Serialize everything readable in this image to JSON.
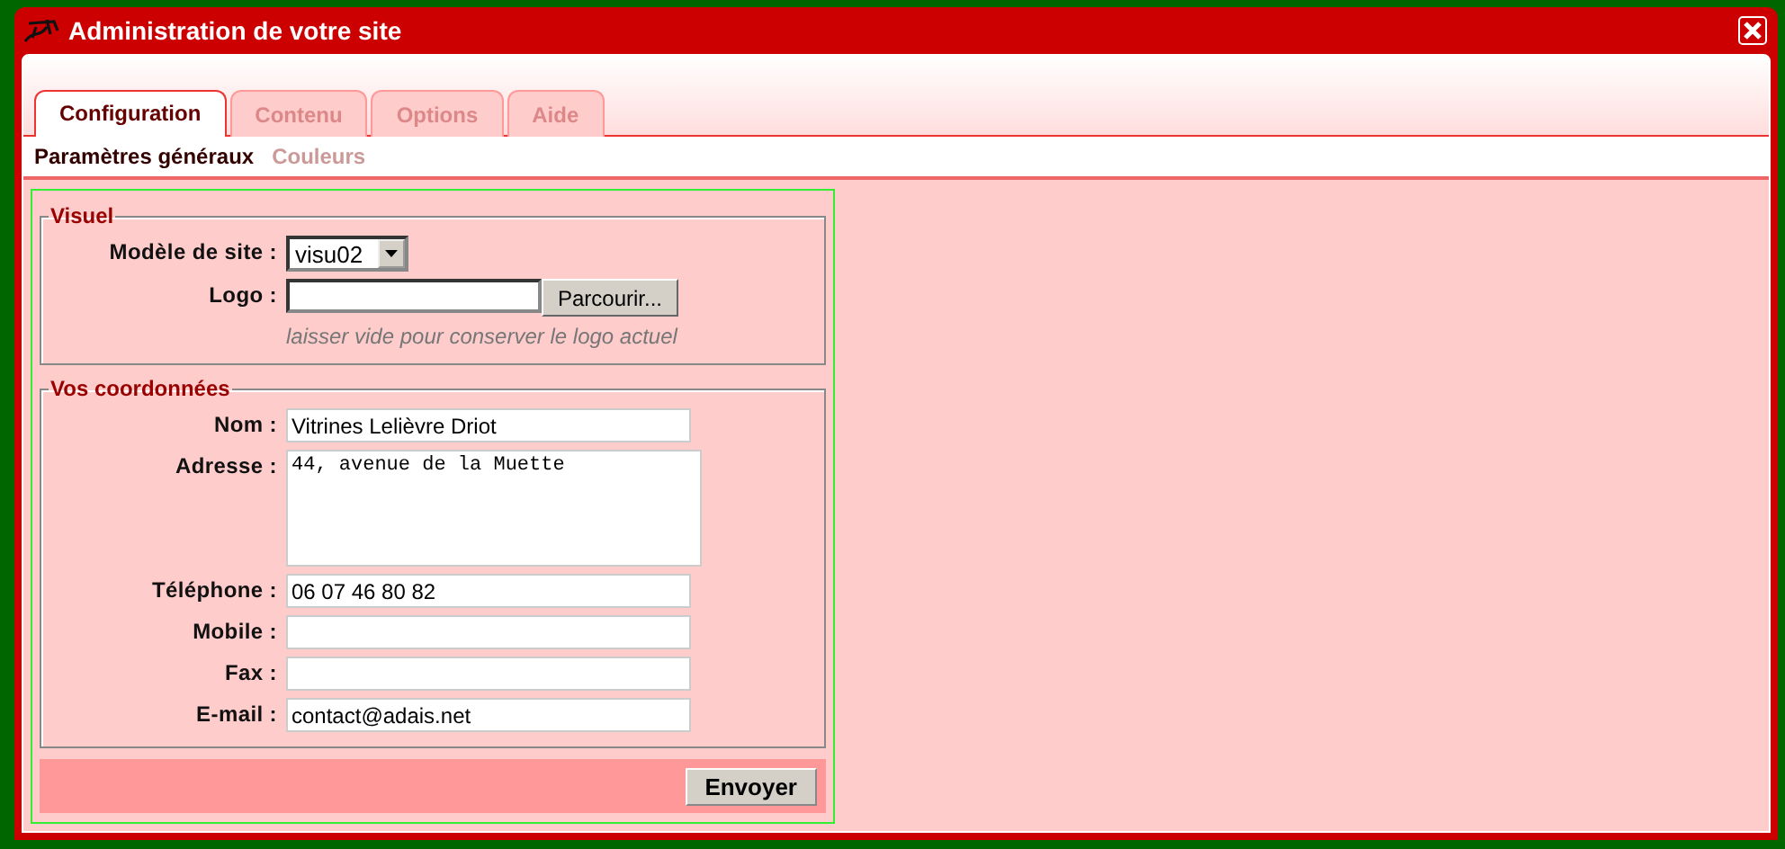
{
  "window": {
    "title": "Administration de votre site"
  },
  "tabs": [
    {
      "label": "Configuration",
      "selected": true
    },
    {
      "label": "Contenu",
      "selected": false
    },
    {
      "label": "Options",
      "selected": false
    },
    {
      "label": "Aide",
      "selected": false
    }
  ],
  "subtabs": [
    {
      "label": "Paramètres généraux",
      "selected": true
    },
    {
      "label": "Couleurs",
      "selected": false
    }
  ],
  "sections": [
    {
      "legend": "Visuel",
      "fields": [
        {
          "kind": "select",
          "label": "Modèle de site :",
          "value": "visu02"
        },
        {
          "kind": "file",
          "label": "Logo :",
          "button": "Parcourir...",
          "hint": "laisser vide pour conserver le logo actuel"
        }
      ]
    },
    {
      "legend": "Vos coordonnées",
      "fields": [
        {
          "kind": "text",
          "label": "Nom :",
          "value": "Vitrines Lelièvre Driot"
        },
        {
          "kind": "textarea",
          "label": "Adresse :",
          "value": "44, avenue de la Muette"
        },
        {
          "kind": "text",
          "label": "Téléphone :",
          "value": "06 07 46 80 82"
        },
        {
          "kind": "text",
          "label": "Mobile :"
        },
        {
          "kind": "text",
          "label": "Fax :"
        },
        {
          "kind": "text",
          "label": "E-mail :",
          "value": "contact@adais.net"
        }
      ]
    }
  ],
  "submit": "Envoyer"
}
